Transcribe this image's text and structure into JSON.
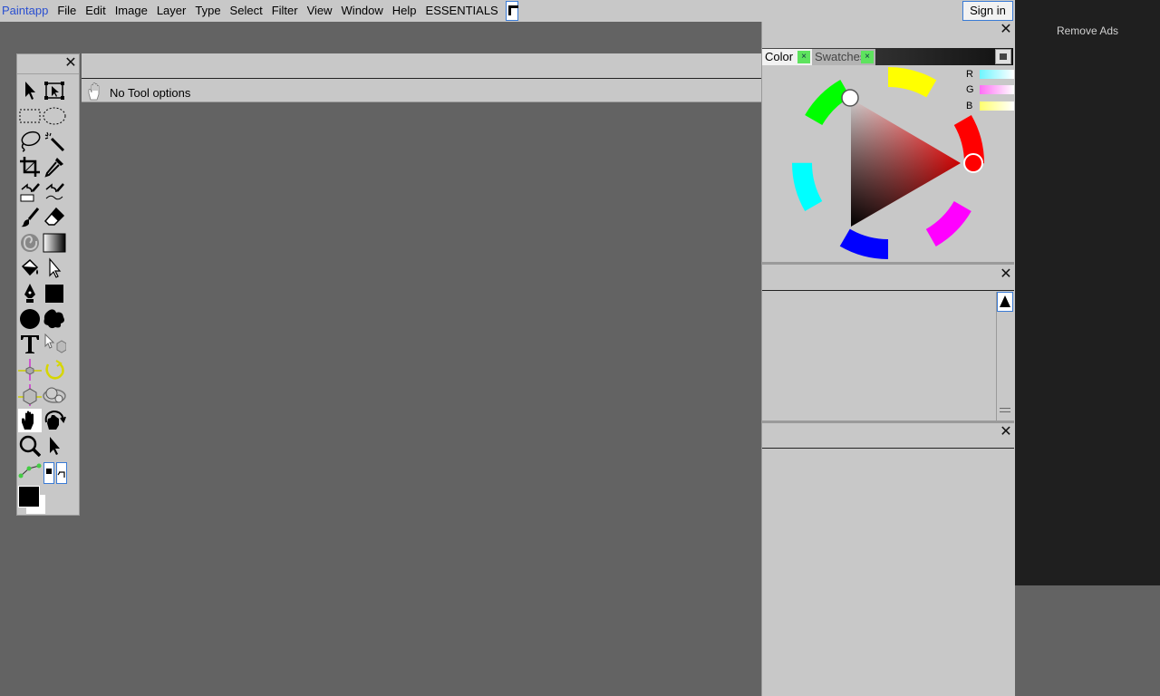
{
  "app": {
    "brand": "Paintapp",
    "menu": [
      "File",
      "Edit",
      "Image",
      "Layer",
      "Type",
      "Select",
      "Filter",
      "View",
      "Window",
      "Help",
      "ESSENTIALS"
    ],
    "sign_in": "Sign in"
  },
  "ads": {
    "remove_label": "Remove Ads"
  },
  "options_bar": {
    "label": "No Tool options"
  },
  "color_panel": {
    "tabs": [
      {
        "label": "Color",
        "close": "×"
      },
      {
        "label": "Swatches",
        "close": "×"
      }
    ],
    "channels": [
      {
        "label": "R",
        "color": "#6ff5ff"
      },
      {
        "label": "G",
        "color": "#ff6ff5"
      },
      {
        "label": "B",
        "color": "#ffff6f"
      }
    ],
    "selected_hue": "#ff0000"
  },
  "colors": {
    "workspace": "#636363",
    "panel": "#c8c8c8",
    "accent": "#3a7bd5",
    "foreground": "#000000",
    "background": "#ffffff"
  }
}
